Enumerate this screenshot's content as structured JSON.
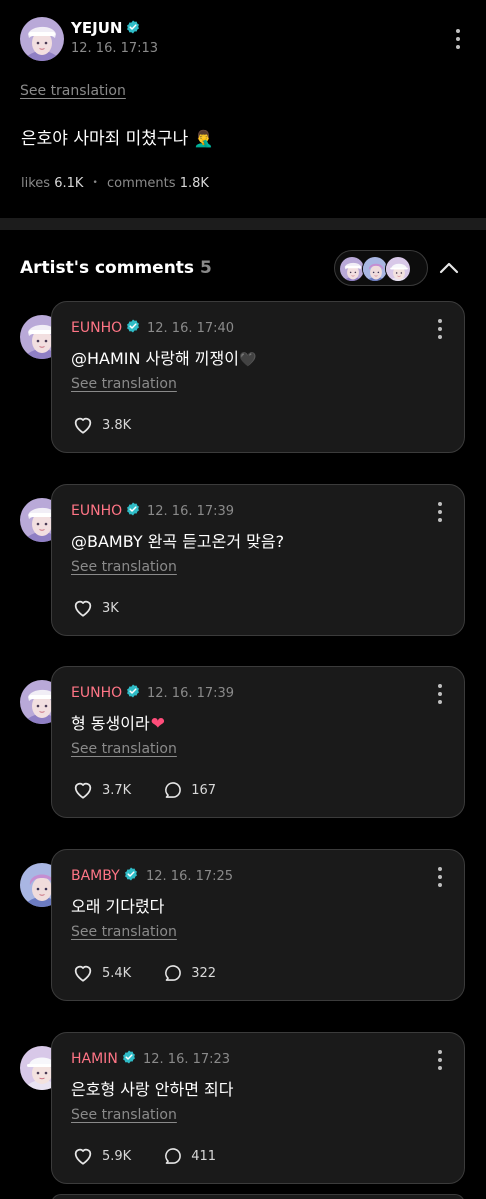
{
  "post": {
    "author": "YEJUN",
    "time": "12. 16. 17:13",
    "see_translation": "See translation",
    "text": "은호야 사마죄 미쳤구나",
    "text_emoji": "🤦‍♂️",
    "likes_label": "likes",
    "likes": "6.1K",
    "separator": "•",
    "comments_label": "comments",
    "comments": "1.8K"
  },
  "section": {
    "title": "Artist's comments",
    "count": "5"
  },
  "comments": [
    {
      "author": "EUNHO",
      "time": "12. 16. 17:40",
      "text": "@HAMIN 사랑해 끼쟁이",
      "emoji": "🖤",
      "see_translation": "See translation",
      "likes": "3.8K",
      "replies": ""
    },
    {
      "author": "EUNHO",
      "time": "12. 16. 17:39",
      "text": "@BAMBY 완곡 듣고온거 맞음?",
      "emoji": "",
      "see_translation": "See translation",
      "likes": "3K",
      "replies": ""
    },
    {
      "author": "EUNHO",
      "time": "12. 16. 17:39",
      "text": "형 동생이라",
      "emoji": "❤",
      "see_translation": "See translation",
      "likes": "3.7K",
      "replies": "167"
    },
    {
      "author": "BAMBY",
      "time": "12. 16. 17:25",
      "text": "오래 기다렸다",
      "emoji": "",
      "see_translation": "See translation",
      "likes": "5.4K",
      "replies": "322"
    },
    {
      "author": "HAMIN",
      "time": "12. 16. 17:23",
      "text": "은호형 사랑 안하면 죄다",
      "emoji": "",
      "see_translation": "See translation",
      "likes": "5.9K",
      "replies": "411"
    }
  ],
  "colors": {
    "background": "#000000",
    "card": "#1a1a1a",
    "artist_name": "#ff7586",
    "verified": "#2fbcc7",
    "muted": "#8a8a8a"
  },
  "icons": [
    "verified-badge-icon",
    "more-vert-icon",
    "heart-icon",
    "comment-bubble-icon",
    "chevron-up-icon"
  ]
}
